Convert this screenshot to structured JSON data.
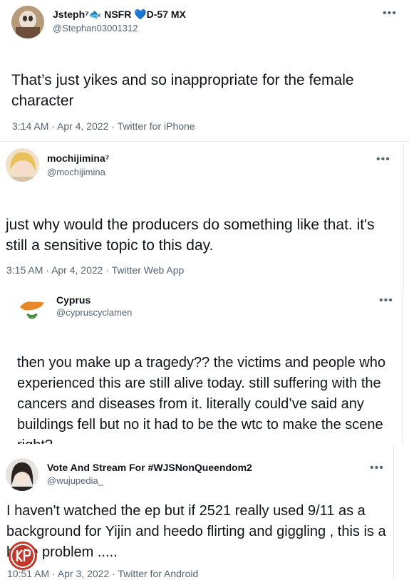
{
  "tweets": [
    {
      "name": "Jsteph⁷🐟 NSFR 💙D-57 MX",
      "handle": "@Stephan03001312",
      "text": "That’s just yikes and so inappropriate for the female character",
      "time": "3:14 AM",
      "date": "Apr 4, 2022",
      "source": "Twitter for iPhone"
    },
    {
      "name": "mochijimina⁷",
      "handle": "@mochijimina",
      "text": "just why would the producers do something like that. it's still a sensitive topic to this day.",
      "time": "3:15 AM",
      "date": "Apr 4, 2022",
      "source": "Twitter Web App"
    },
    {
      "name": "Cyprus",
      "handle": "@cypruscyclamen",
      "text": "then you make up a tragedy?? the victims and people who experienced this are still alive today. still suffering with the cancers and diseases from it. literally could’ve said any buildings fell but no it had to be the wtc to make the scene right?"
    },
    {
      "name": "Vote And Stream For #WJSNonQueendom2",
      "handle": "@wujupedia_",
      "text": "I haven't watched the ep but if 2521 really used 9/11 as a background for Yijin and heedo flirting and giggling , this is a huge problem .....",
      "time": "10:51 AM",
      "date": "Apr 3, 2022",
      "source": "Twitter for Android"
    }
  ],
  "more_glyph": "•••",
  "dot": "·",
  "watermark": "KPF"
}
